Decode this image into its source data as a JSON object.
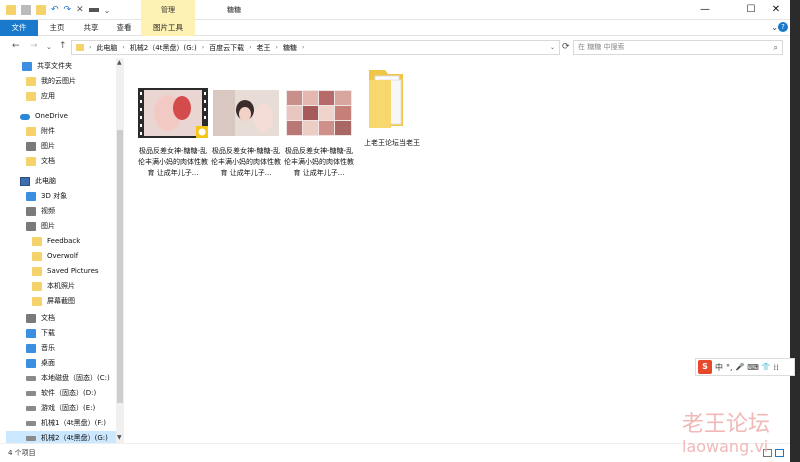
{
  "titlebar": {
    "context_tab": "管理",
    "title": "糖糖",
    "minimize": "—",
    "maximize": "☐",
    "close": "✕"
  },
  "ribbon": {
    "tabs": [
      "文件",
      "主页",
      "共享",
      "查看",
      "图片工具"
    ],
    "toggle": "⌄",
    "help": "?"
  },
  "address": {
    "back": "←",
    "forward": "→",
    "recent": "⌄",
    "up": "↑",
    "crumbs": [
      "此电脑",
      "机械2（4t黑盘）(G:)",
      "百度云下载",
      "老王",
      "糖糖"
    ],
    "refresh": "⟳",
    "search_placeholder": "在 糖糖 中搜索",
    "search_icon": "⌕"
  },
  "nav": [
    {
      "label": "共享文件夹",
      "icon": "share-icon"
    },
    {
      "label": "我的云图片",
      "icon": "folder-icon"
    },
    {
      "label": "应用",
      "icon": "folder-icon"
    },
    {
      "label": "OneDrive",
      "icon": "cloud-icon"
    },
    {
      "label": "附件",
      "icon": "folder-icon"
    },
    {
      "label": "图片",
      "icon": "picture-icon"
    },
    {
      "label": "文档",
      "icon": "folder-icon"
    },
    {
      "label": "此电脑",
      "icon": "pc-icon"
    },
    {
      "label": "3D 对象",
      "icon": "cube-icon"
    },
    {
      "label": "视频",
      "icon": "video-icon"
    },
    {
      "label": "图片",
      "icon": "picture-icon"
    },
    {
      "label": "Feedback",
      "icon": "folder-icon"
    },
    {
      "label": "Overwolf",
      "icon": "folder-icon"
    },
    {
      "label": "Saved Pictures",
      "icon": "folder-icon"
    },
    {
      "label": "本机照片",
      "icon": "folder-icon"
    },
    {
      "label": "屏幕截图",
      "icon": "folder-icon"
    },
    {
      "label": "文档",
      "icon": "document-icon"
    },
    {
      "label": "下载",
      "icon": "download-icon"
    },
    {
      "label": "音乐",
      "icon": "music-icon"
    },
    {
      "label": "桌面",
      "icon": "desktop-icon"
    },
    {
      "label": "本地磁盘（固态）(C:)",
      "icon": "drive-icon"
    },
    {
      "label": "软件（固态）(D:)",
      "icon": "drive-icon"
    },
    {
      "label": "游戏（固态）(E:)",
      "icon": "drive-icon"
    },
    {
      "label": "机械1（4t黑盘）(F:)",
      "icon": "drive-icon"
    },
    {
      "label": "机械2（4t黑盘）(G:)",
      "icon": "drive-icon"
    }
  ],
  "files": [
    {
      "name": "极品反差女神-糖糖-乱伦丰满小妈的肉体性教育 让成年儿子...",
      "type": "video"
    },
    {
      "name": "极品反差女神-糖糖-乱伦丰满小妈的肉体性教育 让成年儿子...",
      "type": "image"
    },
    {
      "name": "极品反差女神-糖糖-乱伦丰满小妈的肉体性教育 让成年儿子...",
      "type": "image"
    },
    {
      "name": "上老王论坛当老王",
      "type": "folder"
    }
  ],
  "status": {
    "count": "4 个项目"
  },
  "ime": {
    "logo": "S",
    "mode": "中",
    "punct": "°,",
    "mic": "🎤",
    "keyboard": "⌨",
    "skin": "👕",
    "grid": "⁞⁞"
  },
  "watermark": {
    "cn": "老王论坛",
    "url": "laowang.vi"
  },
  "colors": {
    "accent": "#1979ca",
    "context": "#fdf1b3",
    "selected": "#cce8ff"
  }
}
